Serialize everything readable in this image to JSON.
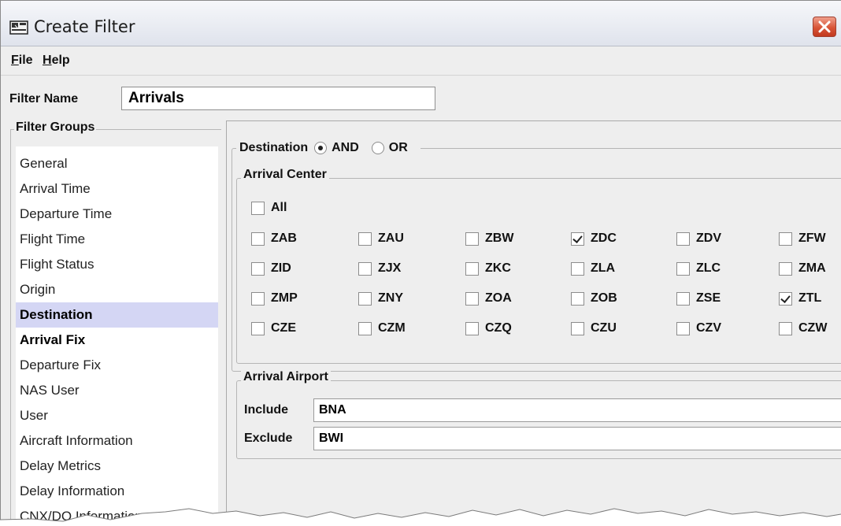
{
  "window": {
    "title": "Create Filter",
    "close_icon": "close-icon"
  },
  "menu": [
    {
      "mnemonic": "F",
      "rest": "ile"
    },
    {
      "mnemonic": "H",
      "rest": "elp"
    }
  ],
  "filter_name": {
    "label": "Filter Name",
    "value": "Arrivals"
  },
  "filter_groups": {
    "title": "Filter Groups",
    "items": [
      {
        "label": "General",
        "state": "normal"
      },
      {
        "label": "Arrival Time",
        "state": "normal"
      },
      {
        "label": "Departure Time",
        "state": "normal"
      },
      {
        "label": "Flight Time",
        "state": "normal"
      },
      {
        "label": "Flight Status",
        "state": "normal"
      },
      {
        "label": "Origin",
        "state": "normal"
      },
      {
        "label": "Destination",
        "state": "selected"
      },
      {
        "label": "Arrival Fix",
        "state": "bold"
      },
      {
        "label": "Departure Fix",
        "state": "normal"
      },
      {
        "label": "NAS User",
        "state": "normal"
      },
      {
        "label": "User",
        "state": "normal"
      },
      {
        "label": "Aircraft Information",
        "state": "normal"
      },
      {
        "label": "Delay Metrics",
        "state": "normal"
      },
      {
        "label": "Delay Information",
        "state": "normal"
      },
      {
        "label": "CNX/DO Information",
        "state": "normal"
      }
    ]
  },
  "destination": {
    "title": "Destination",
    "logic_options": [
      {
        "label": "AND",
        "selected": true
      },
      {
        "label": "OR",
        "selected": false
      }
    ],
    "arrival_center": {
      "title": "Arrival Center",
      "all": {
        "label": "All",
        "checked": false
      },
      "centers": [
        [
          {
            "label": "ZAB",
            "checked": false
          },
          {
            "label": "ZAU",
            "checked": false
          },
          {
            "label": "ZBW",
            "checked": false
          },
          {
            "label": "ZDC",
            "checked": true
          },
          {
            "label": "ZDV",
            "checked": false
          },
          {
            "label": "ZFW",
            "checked": false
          }
        ],
        [
          {
            "label": "ZID",
            "checked": false
          },
          {
            "label": "ZJX",
            "checked": false
          },
          {
            "label": "ZKC",
            "checked": false
          },
          {
            "label": "ZLA",
            "checked": false
          },
          {
            "label": "ZLC",
            "checked": false
          },
          {
            "label": "ZMA",
            "checked": false
          }
        ],
        [
          {
            "label": "ZMP",
            "checked": false
          },
          {
            "label": "ZNY",
            "checked": false
          },
          {
            "label": "ZOA",
            "checked": false
          },
          {
            "label": "ZOB",
            "checked": false
          },
          {
            "label": "ZSE",
            "checked": false
          },
          {
            "label": "ZTL",
            "checked": true
          }
        ],
        [
          {
            "label": "CZE",
            "checked": false
          },
          {
            "label": "CZM",
            "checked": false
          },
          {
            "label": "CZQ",
            "checked": false
          },
          {
            "label": "CZU",
            "checked": false
          },
          {
            "label": "CZV",
            "checked": false
          },
          {
            "label": "CZW",
            "checked": false
          }
        ]
      ]
    },
    "arrival_airport": {
      "title": "Arrival Airport",
      "include": {
        "label": "Include",
        "value": "BNA"
      },
      "exclude": {
        "label": "Exclude",
        "value": "BWI"
      }
    }
  },
  "colors": {
    "selected_row": "#d4d6f4",
    "window_bg": "#eeeeee",
    "close_button": "#d85437"
  }
}
